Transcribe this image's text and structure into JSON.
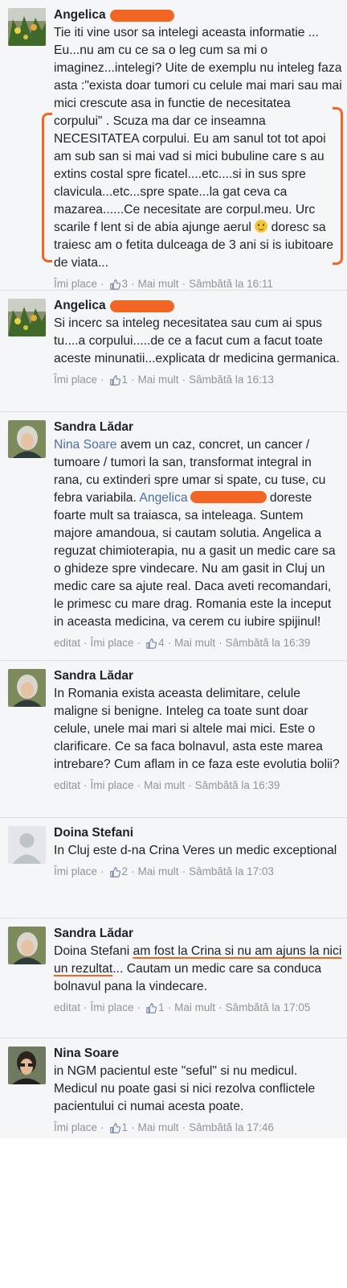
{
  "comments": [
    {
      "author": "Angelica",
      "text_lines": [
        "Tie iti vine usor sa intelegi aceasta informatie ...",
        "Eu...nu am cu ce sa o leg cum sa mi o imaginez...intelegi? Uite de exemplu nu inteleg faza asta :\"exista doar tumori cu celule mai mari sau mai mici crescute asa in functie de necesitatea corpului\" . Scuza ma dar ce inseamna NECESITATEA corpului. Eu am sanul tot tot apoi am sub san si mai vad si mici bubuline care s au extins costal spre ficatel....etc....si in sus spre clavicula...etc...spre spate...la gat ceva ca mazarea......Ce necesitate are corpul.meu. Urc scarile f lent si de abia ajunge aerul",
        "doresc sa traiesc am o fetita dulceaga de 3 ani si is iubitoare de viata..."
      ],
      "edited": "",
      "like_label": "Îmi place",
      "likes": "3",
      "more_label": "Mai mult",
      "time": "Sâmbătă la 16:11"
    },
    {
      "author": "Angelica",
      "text": "Si incerc sa inteleg necesitatea sau cum ai spus tu....a corpului.....de ce a facut cum a facut toate aceste minunatii...explicata dr medicina germanica.",
      "like_label": "Îmi place",
      "likes": "1",
      "more_label": "Mai mult",
      "time": "Sâmbătă la 16:13"
    },
    {
      "author": "Sandra Lădar",
      "mention1": "Nina Soare",
      "text_a": " avem un caz, concret, un cancer / tumoare / tumori la san, transformat integral in rana, cu extinderi spre umar si spate, cu tuse, cu febra variabila. ",
      "mention2": "Angelica",
      "text_b": " doreste foarte mult sa traiasca, sa inteleaga. Suntem majore amandoua, si cautam solutia. Angelica a reguzat chimioterapia, nu a gasit un medic care sa o ghideze spre vindecare. Nu am gasit in Cluj un medic care sa ajute real. Daca aveti recomandari, le primesc cu mare drag. Romania este la inceput in aceasta medicina, va cerem cu iubire spijinul!",
      "edited": "editat",
      "like_label": "Îmi place",
      "likes": "4",
      "more_label": "Mai mult",
      "time": "Sâmbătă la 16:39"
    },
    {
      "author": "Sandra Lădar",
      "text": "In Romania exista aceasta delimitare, celule maligne si benigne. Inteleg ca toate sunt doar celule, unele mai mari si altele mai mici. Este o clarificare. Ce sa faca bolnavul, asta este marea intrebare? Cum aflam in ce faza este evolutia bolii?",
      "edited": "editat",
      "like_label": "Îmi place",
      "more_label": "Mai mult",
      "time": "Sâmbătă la 16:39"
    },
    {
      "author": "Doina Stefani",
      "text": "In Cluj este d-na Crina Veres un medic exceptional",
      "like_label": "Îmi place",
      "likes": "2",
      "more_label": "Mai mult",
      "time": "Sâmbătă la 17:03"
    },
    {
      "author": "Sandra Lădar",
      "mention": "Doina Stefani",
      "text_underlined": "am fost la Crina si nu am ajuns la nici un rezultat",
      "text_rest": "... Cautam un medic care sa conduca bolnavul pana la vindecare.",
      "edited": "editat",
      "like_label": "Îmi place",
      "likes": "1",
      "more_label": "Mai mult",
      "time": "Sâmbătă la 17:05"
    },
    {
      "author": "Nina Soare",
      "text": "in NGM pacientul este \"seful\" si nu medicul. Medicul nu poate gasi si nici rezolva conflictele pacientului ci numai acesta poate.",
      "like_label": "Îmi place",
      "likes": "1",
      "more_label": "Mai mult",
      "time": "Sâmbătă la 17:46"
    }
  ],
  "colors": {
    "highlight": "#f26522",
    "link": "#4d6ea8",
    "meta": "#90949c",
    "text": "#1d2129"
  },
  "icons": [
    "thumbs-up-icon",
    "smiley-emoji-icon"
  ]
}
